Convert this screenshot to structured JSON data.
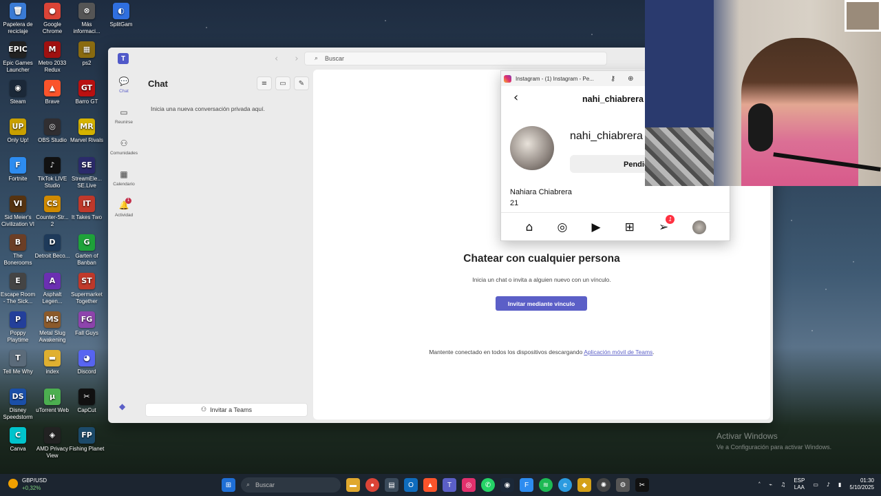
{
  "desktop": {
    "icons": [
      {
        "label": "Papelera de reciclaje",
        "glyph": "🗑",
        "color": "#3a7bd5"
      },
      {
        "label": "Google Chrome",
        "glyph": "●",
        "color": "#db4437"
      },
      {
        "label": "Más informaci...",
        "glyph": "⊗",
        "color": "#555"
      },
      {
        "label": "SplitGam",
        "glyph": "◐",
        "color": "#2f6fe0"
      },
      {
        "label": "Epic Games Launcher",
        "glyph": "EPIC",
        "color": "#222"
      },
      {
        "label": "Metro 2033 Redux",
        "glyph": "M",
        "color": "#a01010"
      },
      {
        "label": "ps2",
        "glyph": "▦",
        "color": "#8a6b10"
      },
      {
        "label": "Steam",
        "glyph": "◉",
        "color": "#1b2838"
      },
      {
        "label": "Brave",
        "glyph": "▲",
        "color": "#fb542b"
      },
      {
        "label": "Barro GT",
        "glyph": "GT",
        "color": "#b11"
      },
      {
        "label": "Only Up!",
        "glyph": "UP",
        "color": "#c9a000"
      },
      {
        "label": "OBS Studio",
        "glyph": "◎",
        "color": "#302e31"
      },
      {
        "label": "Marvel Rivals",
        "glyph": "MR",
        "color": "#d6b300"
      },
      {
        "label": "Fortnite",
        "glyph": "F",
        "color": "#2d8cf0"
      },
      {
        "label": "TikTok LIVE Studio",
        "glyph": "♪",
        "color": "#111"
      },
      {
        "label": "StreamEle... SE.Live",
        "glyph": "SE",
        "color": "#2b2b6b"
      },
      {
        "label": "Sid Meier's Civilization VI",
        "glyph": "VI",
        "color": "#553311"
      },
      {
        "label": "Counter-Str... 2",
        "glyph": "CS",
        "color": "#d08a00"
      },
      {
        "label": "It Takes Two",
        "glyph": "IT",
        "color": "#c0392b"
      },
      {
        "label": "The Bonerooms",
        "glyph": "B",
        "color": "#6b3e26"
      },
      {
        "label": "Detroit Beco...",
        "glyph": "D",
        "color": "#1e3a5a"
      },
      {
        "label": "Garten of Banban",
        "glyph": "G",
        "color": "#1fa33a"
      },
      {
        "label": "Escape Room - The Sick...",
        "glyph": "E",
        "color": "#444"
      },
      {
        "label": "Asphalt Legen...",
        "glyph": "A",
        "color": "#6b2fb2"
      },
      {
        "label": "Supermarket Together",
        "glyph": "ST",
        "color": "#c0392b"
      },
      {
        "label": "Poppy Playtime",
        "glyph": "P",
        "color": "#233f9a"
      },
      {
        "label": "Metal Slug Awakening",
        "glyph": "MS",
        "color": "#8b5a2b"
      },
      {
        "label": "Fall Guys",
        "glyph": "FG",
        "color": "#8e44ad"
      },
      {
        "label": "Tell Me Why",
        "glyph": "T",
        "color": "#5b6b7a"
      },
      {
        "label": "index",
        "glyph": "▬",
        "color": "#e0b030"
      },
      {
        "label": "Discord",
        "glyph": "◕",
        "color": "#5865f2"
      },
      {
        "label": "Disney Speedstorm",
        "glyph": "DS",
        "color": "#1a4fa8"
      },
      {
        "label": "uTorrent Web",
        "glyph": "µ",
        "color": "#4caf50"
      },
      {
        "label": "CapCut",
        "glyph": "✂",
        "color": "#111"
      },
      {
        "label": "Canva",
        "glyph": "C",
        "color": "#00c4cc"
      },
      {
        "label": "AMD Privacy View",
        "glyph": "◈",
        "color": "#222"
      },
      {
        "label": "Fishing Planet",
        "glyph": "FP",
        "color": "#1c4a6a"
      }
    ]
  },
  "teams": {
    "search_placeholder": "Buscar",
    "rail": [
      {
        "label": "Chat",
        "glyph": "💬"
      },
      {
        "label": "Reunirse",
        "glyph": "▭"
      },
      {
        "label": "Comunidades",
        "glyph": "⚇"
      },
      {
        "label": "Calendario",
        "glyph": "▦"
      },
      {
        "label": "Actividad",
        "glyph": "🔔",
        "badge": "1"
      }
    ],
    "chat_title": "Chat",
    "chat_hint": "Inicia una nueva conversación privada aquí.",
    "invite_bar_label": "Invitar a Teams",
    "main_heading": "Chatear con cualquier persona",
    "main_sub": "Inicia un chat o invita a alguien nuevo con un vínculo.",
    "invite_button": "Invitar mediante vínculo",
    "footer_text": "Mantente conectado en todos los dispositivos descargando",
    "footer_link": "Aplicación móvil de Teams",
    "footer_end": "."
  },
  "instagram": {
    "window_title": "Instagram - (1) Instagram - Pe...",
    "username": "nahi_chiabrera",
    "username_big": "nahi_chiabrera",
    "pending_label": "Pendie",
    "full_name": "Nahiara Chiabrera",
    "bio": "21",
    "nav_badge": "1"
  },
  "activate_windows": {
    "title": "Activar Windows",
    "sub": "Ve a Configuración para activar Windows."
  },
  "taskbar": {
    "ticker": "GBP/USD",
    "change": "+0,32%",
    "search_label": "Buscar",
    "lang_1": "ESP",
    "lang_2": "LAA",
    "time": "01:30",
    "date": "5/10/2025"
  }
}
